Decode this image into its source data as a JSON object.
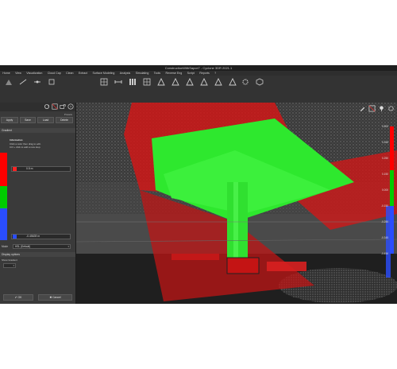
{
  "window": {
    "title": "ConstructionWithSapce7 - Cyclone 3DR 2021.1"
  },
  "menu": [
    "Home",
    "View",
    "Visualization",
    "Cloud Cap",
    "Clean",
    "Extract",
    "Surface Modeling",
    "Analysis",
    "Simulating",
    "Tools",
    "Reverse Eng",
    "Script",
    "Reports",
    "?"
  ],
  "ribbon": {
    "tools": [
      {
        "label": "",
        "icon": "mesh-icon"
      },
      {
        "label": "",
        "icon": "measure-icon"
      },
      {
        "label": "",
        "icon": "level-icon"
      },
      {
        "label": "",
        "icon": "section-icon"
      },
      {
        "label": "",
        "icon": "grid-icon"
      },
      {
        "label": "",
        "icon": "distance-icon"
      },
      {
        "label": "",
        "icon": "columns-icon"
      },
      {
        "label": "",
        "icon": "grid-icon"
      },
      {
        "label": "",
        "icon": "triangle-icon"
      },
      {
        "label": "",
        "icon": "triangle-icon"
      },
      {
        "label": "",
        "icon": "triangle-icon"
      },
      {
        "label": "",
        "icon": "triangle-icon"
      },
      {
        "label": "",
        "icon": "triangle-icon"
      },
      {
        "label": "",
        "icon": "triangle-icon"
      },
      {
        "label": "",
        "icon": "gear-icon"
      },
      {
        "label": "",
        "icon": "cube-icon"
      }
    ]
  },
  "side_panel": {
    "title": "",
    "subtitle": "Presets",
    "buttons": [
      "Apply",
      "Save",
      "Load",
      "Delete"
    ],
    "section1": "Gradient",
    "info_header": "Information",
    "info_lines": [
      "Click a color then drag to edit.",
      "Ctrl + click to add a new step."
    ],
    "values": [
      "0.5 m",
      "-0.45639 m"
    ],
    "gradient_colors": [
      "#ff0000",
      "#00cc00",
      "#2a4dff"
    ],
    "option_label": "Mode",
    "option_value": "HSL (Default)",
    "section2": "Display options",
    "sub_label": "Show Gradient",
    "sub_value": "",
    "ok_label": "OK",
    "cancel_label": "Cancel"
  },
  "viewport": {
    "scale_labels": [
      "0.500",
      "0.345",
      "0.250",
      "0.150",
      "0.000",
      "-0.150",
      "-0.250",
      "-0.345",
      "-0.456"
    ],
    "colors": {
      "green": "#2ee82e",
      "red": "#e01818",
      "blue": "#2a4dff"
    }
  }
}
